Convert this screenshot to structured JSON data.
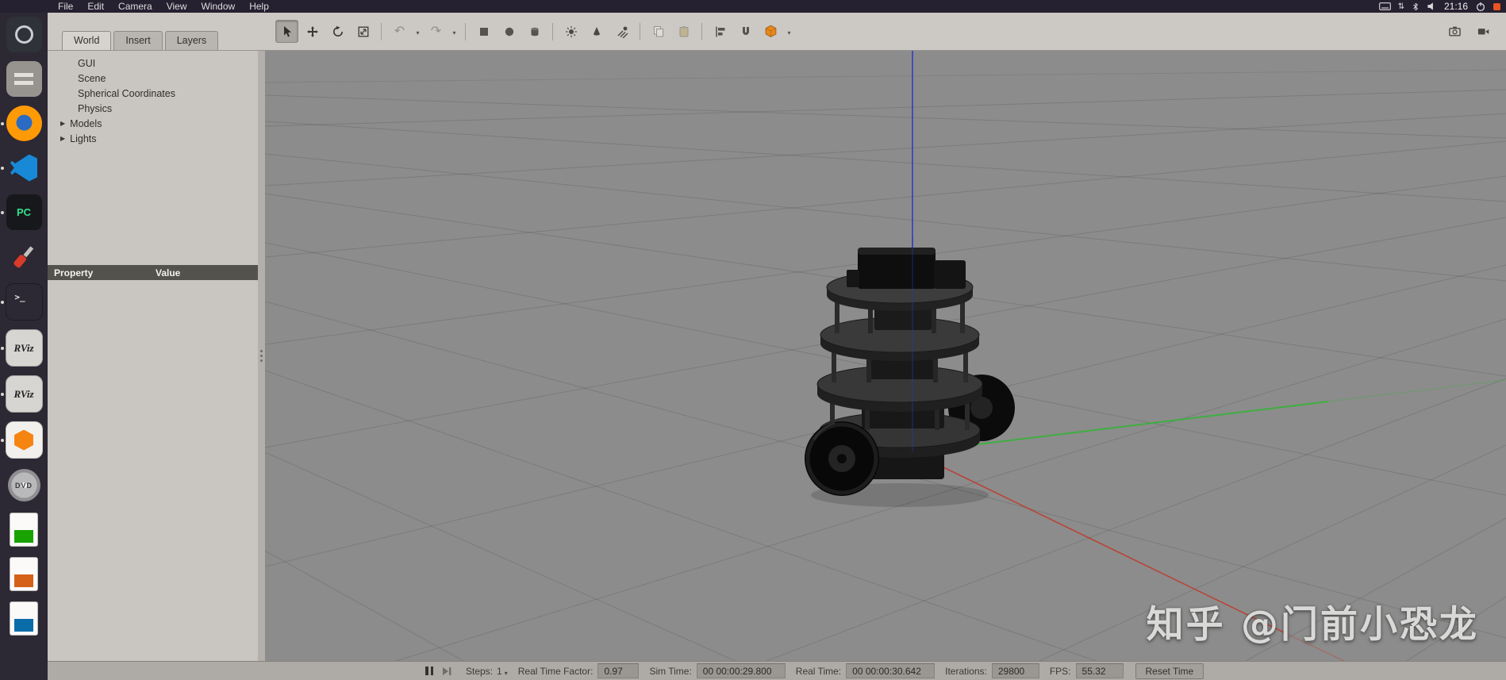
{
  "system_bar": {
    "menus": [
      "File",
      "Edit",
      "Camera",
      "View",
      "Window",
      "Help"
    ],
    "time": "21:16",
    "tray_updown_glyph": "⇅",
    "tray_icons": [
      "keyboard-icon",
      "updown-arrows-icon",
      "bluetooth-icon",
      "volume-icon",
      "clock",
      "power-icon",
      "recording-indicator-icon"
    ]
  },
  "dock": {
    "items": [
      {
        "name": "settings",
        "running": false
      },
      {
        "name": "files",
        "running": false
      },
      {
        "name": "firefox",
        "running": true
      },
      {
        "name": "vscode",
        "running": true
      },
      {
        "name": "pycharm",
        "running": true,
        "text": "PC"
      },
      {
        "name": "tools",
        "running": false
      },
      {
        "name": "terminal",
        "running": true,
        "text": ">_"
      },
      {
        "name": "rviz",
        "running": true,
        "text": "RViz"
      },
      {
        "name": "rviz2",
        "running": true,
        "text": "RViz"
      },
      {
        "name": "gazebo",
        "running": true
      },
      {
        "name": "dvd",
        "running": false,
        "text": "DVD"
      },
      {
        "name": "libreoffice-calc",
        "running": false
      },
      {
        "name": "libreoffice-impress",
        "running": false
      },
      {
        "name": "libreoffice-writer",
        "running": false
      }
    ]
  },
  "panel": {
    "tabs": [
      {
        "label": "World",
        "active": true
      },
      {
        "label": "Insert",
        "active": false
      },
      {
        "label": "Layers",
        "active": false
      }
    ],
    "tree": [
      {
        "label": "GUI"
      },
      {
        "label": "Scene"
      },
      {
        "label": "Spherical Coordinates"
      },
      {
        "label": "Physics"
      },
      {
        "label": "Models",
        "expandable": true
      },
      {
        "label": "Lights",
        "expandable": true
      }
    ],
    "columns": {
      "property": "Property",
      "value": "Value"
    }
  },
  "toolbar": {
    "tools": [
      "select",
      "translate",
      "rotate",
      "scale",
      "undo",
      "redo",
      "box",
      "sphere",
      "cylinder",
      "point-light",
      "spot-light",
      "directional-light",
      "copy",
      "paste",
      "align",
      "snap",
      "view-angle"
    ],
    "right_tools": [
      "screenshot",
      "record-video"
    ],
    "undo_glyph": "↶",
    "redo_glyph": "↷"
  },
  "ui": {
    "expander_glyph": "▶",
    "caret_glyph": "▾"
  },
  "statusbar": {
    "steps_label": "Steps:",
    "steps_value": "1",
    "rtf_label": "Real Time Factor:",
    "rtf_value": "0.97",
    "sim_label": "Sim Time:",
    "sim_value": "00 00:00:29.800",
    "real_label": "Real Time:",
    "real_value": "00 00:00:30.642",
    "iter_label": "Iterations:",
    "iter_value": "29800",
    "fps_label": "FPS:",
    "fps_value": "55.32",
    "reset_label": "Reset Time"
  },
  "viewport": {
    "watermark": "知乎 @门前小恐龙",
    "axis_colors": {
      "x": "#bf3a2c",
      "y": "#3fae3f",
      "z": "#2a35c8"
    },
    "background": "#8c8c8c"
  }
}
